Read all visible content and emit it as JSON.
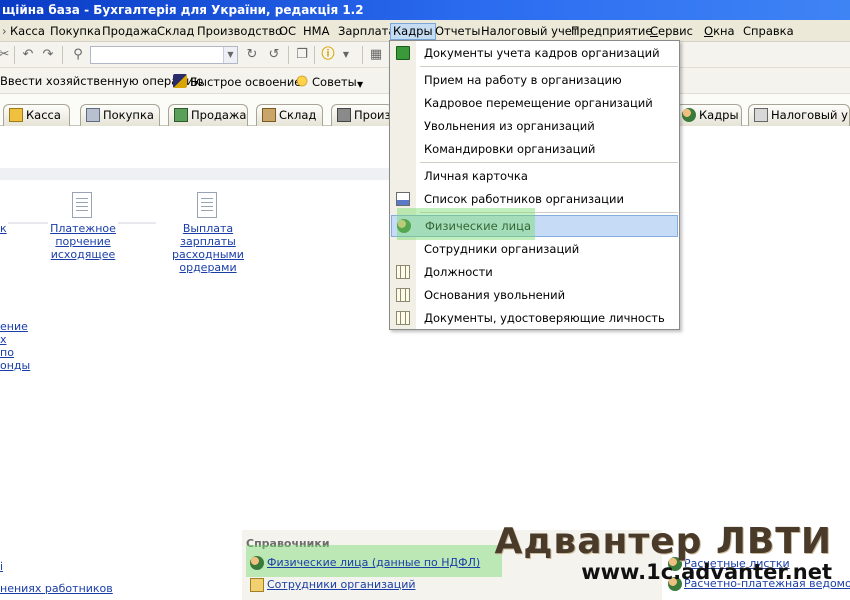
{
  "window": {
    "title": "щійна база - Бухгалтерія для України, редакція 1.2"
  },
  "menubar": {
    "items": [
      {
        "label": "Касса"
      },
      {
        "label": "Покупка"
      },
      {
        "label": "Продажа"
      },
      {
        "label": "Склад"
      },
      {
        "label": "Производство"
      },
      {
        "label": "ОС"
      },
      {
        "label": "НМА"
      },
      {
        "label": "Зарплата"
      },
      {
        "label": "Кадры"
      },
      {
        "label": "Отчеты"
      },
      {
        "label": "Налоговый учет"
      },
      {
        "label": "Предприятие"
      },
      {
        "label": "Сервис"
      },
      {
        "label": "Окна"
      },
      {
        "label": "Справка"
      }
    ]
  },
  "toolbar2": {
    "enter_operation": "Ввести хозяйственную операцию",
    "quick_start": "Быстрое освоение",
    "tips": "Советы"
  },
  "tabs": [
    {
      "label": "Касса"
    },
    {
      "label": "Покупка"
    },
    {
      "label": "Продажа"
    },
    {
      "label": "Склад"
    },
    {
      "label": "Произ"
    },
    {
      "label": "Кадры"
    },
    {
      "label": "Налоговый у..."
    }
  ],
  "desktop": {
    "doc1": "Платежное порчение исходящее",
    "doc2": "Выплата зарплаты расходными ордерами",
    "left_frag_top": "к",
    "left_frag_lines": [
      "ение",
      "х",
      "по",
      "онды"
    ]
  },
  "kadry_menu": {
    "items": [
      {
        "label": "Документы учета кадров организаций",
        "icon": "green-book-icon"
      },
      {
        "label": "Прием на работу в организацию"
      },
      {
        "label": "Кадровое перемещение организаций"
      },
      {
        "label": "Увольнения из организаций"
      },
      {
        "label": "Командировки организаций"
      },
      {
        "label": "Личная карточка"
      },
      {
        "label": "Список работников организации",
        "icon": "report-icon"
      },
      {
        "label": "Физические лица",
        "icon": "people-icon",
        "selected": true
      },
      {
        "label": "Сотрудники организаций"
      },
      {
        "label": "Должности",
        "icon": "grid-icon"
      },
      {
        "label": "Основания увольнений",
        "icon": "grid-icon"
      },
      {
        "label": "Документы, удостоверяющие личность",
        "icon": "grid-icon"
      }
    ]
  },
  "bottom": {
    "section_title": "Справочники",
    "link1": "Физические лица (данные по НДФЛ)",
    "link2": "Сотрудники организаций",
    "left_link_top": "і",
    "left_link_bottom": "нениях работников",
    "right_link1": "Расчетные листки",
    "right_link2": "Расчетно-платежная ведомость"
  },
  "watermark": {
    "line1": "Адвантер ЛВТИ",
    "line2": "www.1c.advanter.net"
  },
  "colors": {
    "titlebar": "#0a3bc5",
    "menu_active": "#c5dcf3",
    "menu_selected": "#c6dcf6",
    "link": "#1a3ea8",
    "highlight": "#78dc6e"
  }
}
